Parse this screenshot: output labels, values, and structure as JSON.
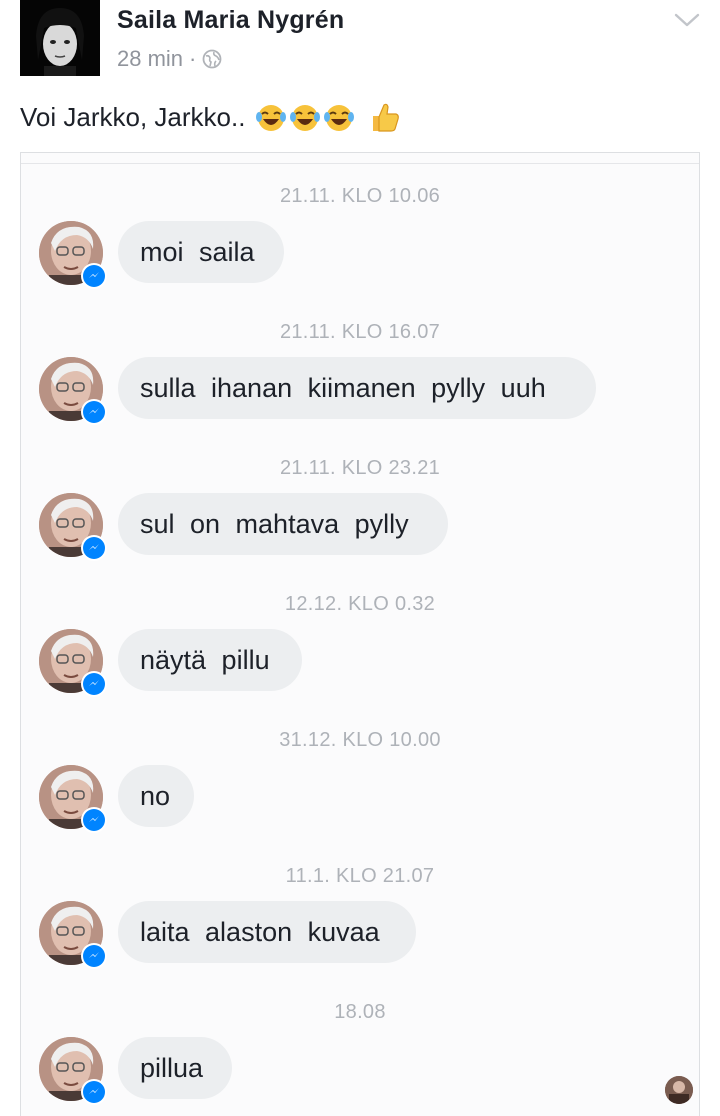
{
  "post": {
    "author": "Saila Maria Nygrén",
    "time": "28 min",
    "separator": "·",
    "caption": "Voi Jarkko, Jarkko.."
  },
  "icons": {
    "privacy": "globe-icon",
    "menu": "chevron-down-icon",
    "emoji_laugh": "face-with-tears-of-joy-icon",
    "emoji_thumb": "thumbs-up-icon",
    "messenger": "messenger-icon"
  },
  "colors": {
    "messenger_blue": "#0084ff",
    "bubble_gray": "#eceef0",
    "timestamp_gray": "#aeb2b8"
  },
  "messages": [
    {
      "timestamp": "21.11. KLO 10.06",
      "text": "moi saila"
    },
    {
      "timestamp": "21.11. KLO 16.07",
      "text": "sulla ihanan kiimanen pylly uuh"
    },
    {
      "timestamp": "21.11. KLO 23.21",
      "text": "sul on mahtava pylly"
    },
    {
      "timestamp": "12.12. KLO 0.32",
      "text": "näytä pillu"
    },
    {
      "timestamp": "31.12. KLO 10.00",
      "text": "no"
    },
    {
      "timestamp": "11.1. KLO 21.07",
      "text": "laita alaston kuvaa"
    },
    {
      "timestamp": "18.08",
      "text": "pillua"
    }
  ]
}
